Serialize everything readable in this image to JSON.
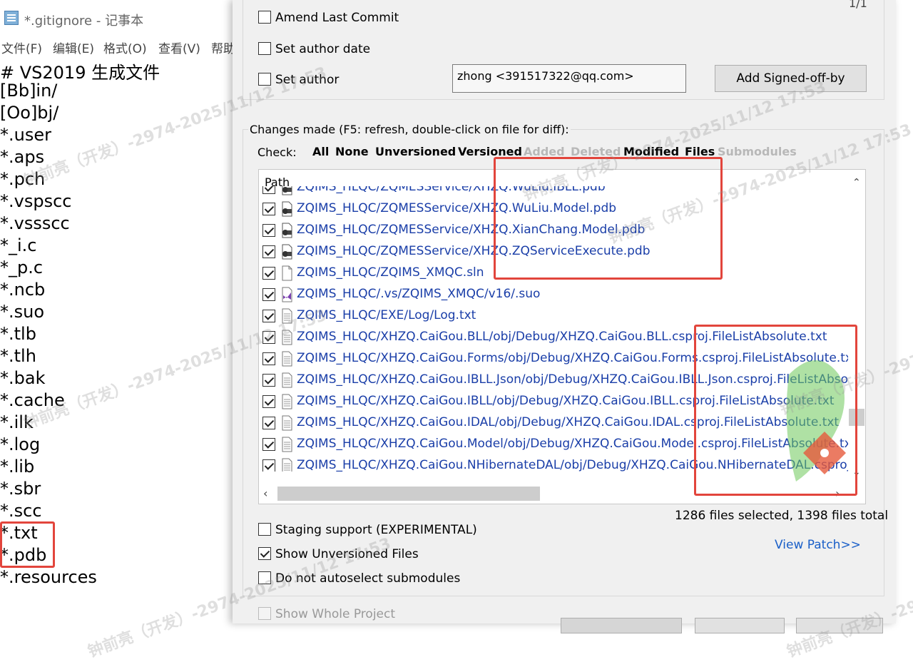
{
  "notepad": {
    "title": "*.gitignore - 记事本",
    "menu": [
      "文件(F)",
      "编辑(E)",
      "格式(O)",
      "查看(V)",
      "帮助"
    ],
    "lines": [
      "# VS2019 生成文件",
      "[Bb]in/",
      "[Oo]bj/",
      "*.user",
      "*.aps",
      "*.pch",
      "*.vspscc",
      "*.vssscc",
      "*_i.c",
      "*_p.c",
      "*.ncb",
      "*.suo",
      "*.tlb",
      "*.tlh",
      "*.bak",
      "*.cache",
      "*.ilk",
      "*.log",
      "*.lib",
      "*.sbr",
      "*.scc",
      "*.txt",
      "*.pdb",
      "*.resources"
    ]
  },
  "dialog": {
    "counter": "1/1",
    "amend_last_commit": {
      "label": "Amend Last Commit",
      "checked": false
    },
    "set_author_date": {
      "label": "Set author date",
      "checked": false
    },
    "set_author": {
      "label": "Set author",
      "checked": false
    },
    "author_value": "zhong <391517322@qq.com>",
    "signed_off_button": "Add Signed-off-by",
    "changes_label": "Changes made (F5: refresh, double-click on file for diff):",
    "check_label": "Check:",
    "filters": [
      {
        "label": "All",
        "enabled": true
      },
      {
        "label": "None",
        "enabled": true
      },
      {
        "label": "Unversioned",
        "enabled": true
      },
      {
        "label": "Versioned",
        "enabled": true
      },
      {
        "label": "Added",
        "enabled": false
      },
      {
        "label": "Deleted",
        "enabled": false
      },
      {
        "label": "Modified",
        "enabled": true
      },
      {
        "label": "Files",
        "enabled": true
      },
      {
        "label": "Submodules",
        "enabled": false
      }
    ],
    "file_list": {
      "header": "Path",
      "rows": [
        {
          "path": "ZQIMS_HLQC/ZQMESService/XHZQ.WuLiu.IBLL.pdb",
          "icon": "pdb-file-icon",
          "checked": true
        },
        {
          "path": "ZQIMS_HLQC/ZQMESService/XHZQ.WuLiu.Model.pdb",
          "icon": "pdb-file-icon",
          "checked": true
        },
        {
          "path": "ZQIMS_HLQC/ZQMESService/XHZQ.XianChang.Model.pdb",
          "icon": "pdb-file-icon",
          "checked": true
        },
        {
          "path": "ZQIMS_HLQC/ZQMESService/XHZQ.ZQServiceExecute.pdb",
          "icon": "pdb-file-icon",
          "checked": true
        },
        {
          "path": "ZQIMS_HLQC/ZQIMS_XMQC.sln",
          "icon": "blank-file-icon",
          "checked": true
        },
        {
          "path": "ZQIMS_HLQC/.vs/ZQIMS_XMQC/v16/.suo",
          "icon": "visual-studio-file-icon",
          "checked": true
        },
        {
          "path": "ZQIMS_HLQC/EXE/Log/Log.txt",
          "icon": "text-file-icon",
          "checked": true
        },
        {
          "path": "ZQIMS_HLQC/XHZQ.CaiGou.BLL/obj/Debug/XHZQ.CaiGou.BLL.csproj.FileListAbsolute.txt",
          "icon": "text-file-icon",
          "checked": true
        },
        {
          "path": "ZQIMS_HLQC/XHZQ.CaiGou.Forms/obj/Debug/XHZQ.CaiGou.Forms.csproj.FileListAbsolute.txt",
          "icon": "text-file-icon",
          "checked": true
        },
        {
          "path": "ZQIMS_HLQC/XHZQ.CaiGou.IBLL.Json/obj/Debug/XHZQ.CaiGou.IBLL.Json.csproj.FileListAbsolute.t",
          "icon": "text-file-icon",
          "checked": true
        },
        {
          "path": "ZQIMS_HLQC/XHZQ.CaiGou.IBLL/obj/Debug/XHZQ.CaiGou.IBLL.csproj.FileListAbsolute.txt",
          "icon": "text-file-icon",
          "checked": true
        },
        {
          "path": "ZQIMS_HLQC/XHZQ.CaiGou.IDAL/obj/Debug/XHZQ.CaiGou.IDAL.csproj.FileListAbsolute.txt",
          "icon": "text-file-icon",
          "checked": true
        },
        {
          "path": "ZQIMS_HLQC/XHZQ.CaiGou.Model/obj/Debug/XHZQ.CaiGou.Model.csproj.FileListAbsolute.txt",
          "icon": "text-file-icon",
          "checked": true
        },
        {
          "path": "ZQIMS_HLQC/XHZQ.CaiGou.NHibernateDAL/obj/Debug/XHZQ.CaiGou.NHibernateDAL.csproj.FileL",
          "icon": "text-file-icon",
          "checked": true
        }
      ]
    },
    "files_summary": "1286 files selected, 1398 files total",
    "staging_support": {
      "label": "Staging support (EXPERIMENTAL)",
      "checked": false
    },
    "show_unversioned": {
      "label": "Show Unversioned Files",
      "checked": true
    },
    "no_autoselect": {
      "label": "Do not autoselect submodules",
      "checked": false
    },
    "view_patch": "View Patch>>",
    "show_whole_project": {
      "label": "Show Whole Project",
      "checked": false,
      "enabled": false
    }
  },
  "watermark": {
    "text": "钟前亮（开发）-2974-2025/11/12 17:53"
  },
  "colors": {
    "accent_red": "#e2453c",
    "file_link_blue": "#1a3ea8",
    "link_blue": "#1a5fc8",
    "disabled_gray": "#b8b8b8"
  }
}
